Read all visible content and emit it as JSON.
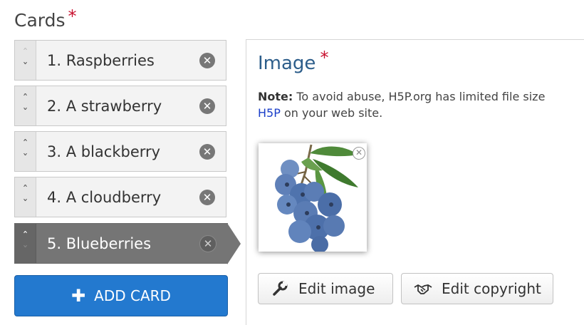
{
  "cards_section": {
    "title": "Cards",
    "required_mark": "*",
    "items": [
      {
        "label": "1. Raspberries",
        "up_icon": "chevron-up-icon",
        "down_icon": "chevron-down-icon",
        "remove_icon": "close-icon",
        "active": false
      },
      {
        "label": "2. A strawberry",
        "up_icon": "chevron-up-icon",
        "down_icon": "chevron-down-icon",
        "remove_icon": "close-icon",
        "active": false
      },
      {
        "label": "3. A blackberry",
        "up_icon": "chevron-up-icon",
        "down_icon": "chevron-down-icon",
        "remove_icon": "close-icon",
        "active": false
      },
      {
        "label": "4. A cloudberry",
        "up_icon": "chevron-up-icon",
        "down_icon": "chevron-down-icon",
        "remove_icon": "close-icon",
        "active": false
      },
      {
        "label": "5. Blueberries",
        "up_icon": "chevron-up-icon",
        "down_icon": "chevron-down-icon",
        "remove_icon": "close-icon",
        "active": true
      }
    ],
    "add_button_label": "ADD CARD",
    "add_button_icon": "plus-icon"
  },
  "image_field": {
    "title": "Image",
    "required_mark": "*",
    "note_label": "Note:",
    "note_text": " To avoid abuse, H5P.org has limited file size",
    "note_link": "H5P",
    "note_text_2": " on your web site.",
    "thumbnail_alt": "blueberries-image",
    "edit_image_label": "Edit image",
    "edit_image_icon": "wrench-icon",
    "edit_copyright_label": "Edit copyright",
    "edit_copyright_icon": "handshake-icon"
  },
  "colors": {
    "accent_blue": "#2379cf",
    "title_blue": "#2c5d8a",
    "required_red": "#c8102e",
    "active_card": "#757575"
  }
}
